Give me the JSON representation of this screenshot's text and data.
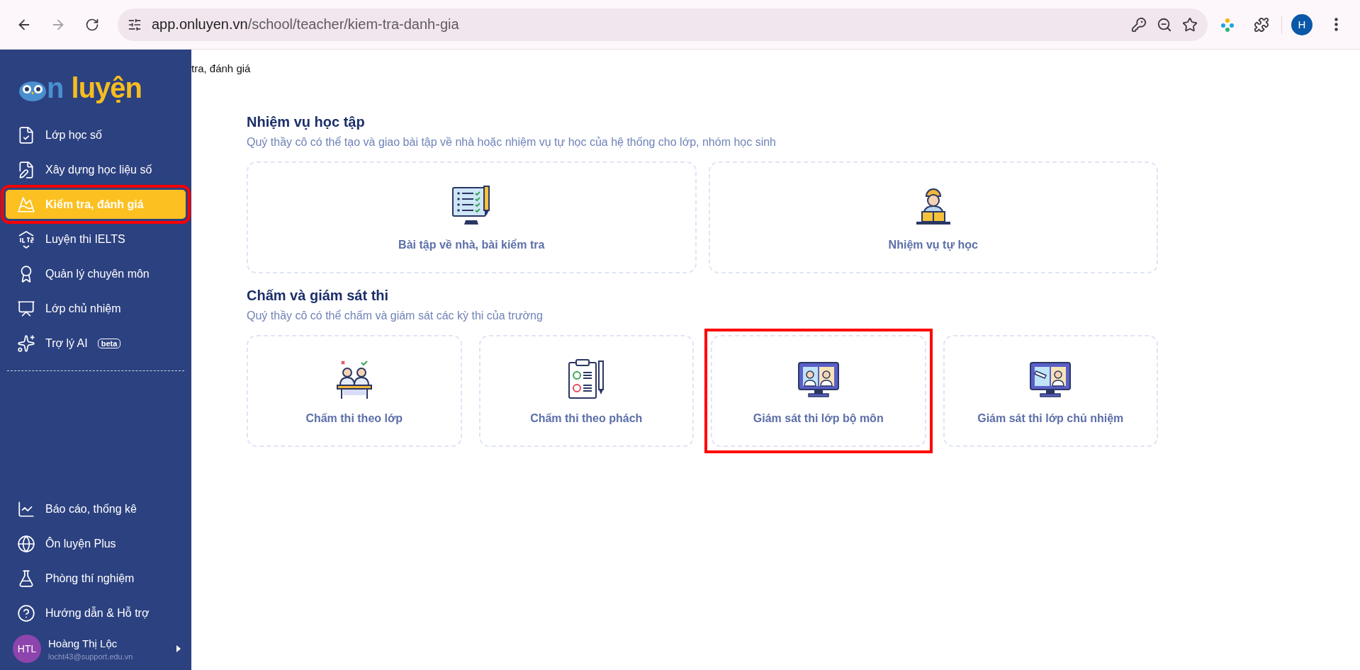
{
  "browser": {
    "url_host": "app.onluyen.vn",
    "url_path": "/school/teacher/kiem-tra-danh-gia",
    "profile_initial": "H",
    "forward_disabled": true
  },
  "sidebar": {
    "logo": {
      "prefix": "n",
      "word": "luyện"
    },
    "items": [
      {
        "label": "Lớp học số",
        "selected": false,
        "highlighted": false
      },
      {
        "label": "Xây dựng học liệu số",
        "selected": false,
        "highlighted": false
      },
      {
        "label": "Kiểm tra, đánh giá",
        "selected": true,
        "highlighted": true
      },
      {
        "label": "Luyện thi IELTS",
        "selected": false,
        "highlighted": false
      },
      {
        "label": "Quản lý chuyên môn",
        "selected": false,
        "highlighted": false
      },
      {
        "label": "Lớp chủ nhiệm",
        "selected": false,
        "highlighted": false
      },
      {
        "label": "Trợ lý AI",
        "badge": "beta",
        "selected": false,
        "highlighted": false
      }
    ],
    "bottom_items": [
      {
        "label": "Báo cáo, thống kê",
        "selected": false
      },
      {
        "label": "Ôn luyện Plus",
        "selected": false
      },
      {
        "label": "Phòng thí nghiệm",
        "selected": false
      },
      {
        "label": "Hướng dẫn & Hỗ trợ",
        "selected": false
      }
    ],
    "user": {
      "initials": "HTL",
      "name": "Hoàng Thị Lộc",
      "email": "locht43@support.edu.vn"
    }
  },
  "breadcrumb": "tra, đánh giá",
  "sections": [
    {
      "title": "Nhiệm vụ học tập",
      "description": "Quý thầy cô có thể tạo và giao bài tập về nhà hoặc nhiệm vụ tự học của hệ thống cho lớp, nhóm học sinh",
      "cards": [
        {
          "label": "Bài tập về nhà, bài kiểm tra",
          "highlighted": false
        },
        {
          "label": "Nhiệm vụ tự học",
          "highlighted": false
        }
      ]
    },
    {
      "title": "Chấm và giám sát thi",
      "description": "Quý thầy cô có thể chấm và giám sát các kỳ thi của trường",
      "cards": [
        {
          "label": "Chấm thi theo lớp",
          "highlighted": false
        },
        {
          "label": "Chấm thi theo phách",
          "highlighted": false
        },
        {
          "label": "Giám sát thi lớp bộ môn",
          "highlighted": true
        },
        {
          "label": "Giám sát thi lớp chủ nhiệm",
          "highlighted": false
        }
      ]
    }
  ]
}
